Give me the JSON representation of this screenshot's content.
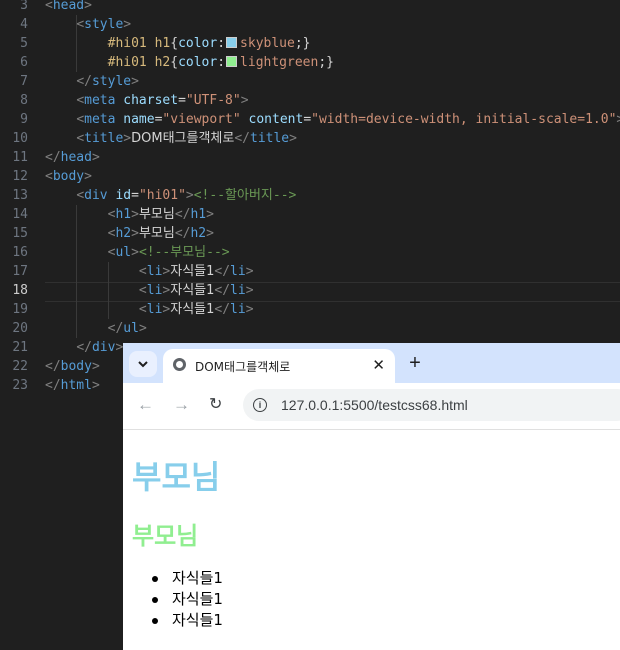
{
  "editor": {
    "line_numbers": [
      "3",
      "4",
      "5",
      "6",
      "7",
      "8",
      "9",
      "10",
      "11",
      "12",
      "13",
      "14",
      "15",
      "16",
      "17",
      "18",
      "19",
      "20",
      "21",
      "22",
      "23"
    ],
    "active_line": "18",
    "lines": {
      "l3": {
        "open": "<",
        "tag": "head",
        "close": ">"
      },
      "l4": {
        "open": "<",
        "tag": "style",
        "close": ">"
      },
      "l5": {
        "sel": "#hi01 h1",
        "brace": "{",
        "prop": "color",
        "colon": ":",
        "swatch": "#87ceeb",
        "val": "skyblue",
        "end": ";}"
      },
      "l6": {
        "sel": "#hi01 h2",
        "brace": "{",
        "prop": "color",
        "colon": ":",
        "swatch": "#90ee90",
        "val": "lightgreen",
        "end": ";}"
      },
      "l7": {
        "open": "</",
        "tag": "style",
        "close": ">"
      },
      "l8": {
        "open": "<",
        "tag": "meta",
        "attr1": "charset",
        "eq": "=",
        "str1": "\"UTF-8\"",
        "close": ">"
      },
      "l9": {
        "open": "<",
        "tag": "meta",
        "attr1": "name",
        "eq": "=",
        "str1": "\"viewport\"",
        "attr2": "content",
        "str2": "\"width=device-width, initial-scale=1.0\"",
        "close": ">"
      },
      "l10": {
        "open": "<",
        "tag": "title",
        "close": ">",
        "text": "DOM태그를객체로",
        "open2": "</",
        "tag2": "title",
        "close2": ">"
      },
      "l11": {
        "open": "</",
        "tag": "head",
        "close": ">"
      },
      "l12": {
        "open": "<",
        "tag": "body",
        "close": ">"
      },
      "l13": {
        "open": "<",
        "tag": "div",
        "attr1": "id",
        "eq": "=",
        "str1": "\"hi01\"",
        "close": ">",
        "comment": "<!--할아버지-->"
      },
      "l14": {
        "open": "<",
        "tag": "h1",
        "close": ">",
        "text": "부모님",
        "open2": "</",
        "tag2": "h1",
        "close2": ">"
      },
      "l15": {
        "open": "<",
        "tag": "h2",
        "close": ">",
        "text": "부모님",
        "open2": "</",
        "tag2": "h2",
        "close2": ">"
      },
      "l16": {
        "open": "<",
        "tag": "ul",
        "close": ">",
        "comment": "<!--부모님-->"
      },
      "l17": {
        "open": "<",
        "tag": "li",
        "close": ">",
        "text": "자식들1",
        "open2": "</",
        "tag2": "li",
        "close2": ">"
      },
      "l18": {
        "open": "<",
        "tag": "li",
        "close": ">",
        "text": "자식들1",
        "open2": "</",
        "tag2": "li",
        "close2": ">"
      },
      "l19": {
        "open": "<",
        "tag": "li",
        "close": ">",
        "text": "자식들1",
        "open2": "</",
        "tag2": "li",
        "close2": ">"
      },
      "l20": {
        "open": "</",
        "tag": "ul",
        "close": ">"
      },
      "l21": {
        "open": "</",
        "tag": "div",
        "close": ">"
      },
      "l22": {
        "open": "</",
        "tag": "body",
        "close": ">"
      },
      "l23": {
        "open": "</",
        "tag": "html",
        "close": ">"
      }
    }
  },
  "browser": {
    "tab_search_icon": "chevron-down-icon",
    "tab": {
      "icon": "globe-icon",
      "title": "DOM태그를객체로",
      "close_glyph": "✕"
    },
    "new_tab_glyph": "+",
    "toolbar": {
      "back_glyph": "←",
      "forward_glyph": "→",
      "reload_glyph": "↻",
      "info_glyph": "i",
      "url": "127.0.0.1:5500/testcss68.html"
    },
    "page": {
      "h1": "부모님",
      "h1_color": "#87ceeb",
      "h2": "부모님",
      "h2_color": "#90ee90",
      "list_items": [
        "자식들1",
        "자식들1",
        "자식들1"
      ]
    }
  }
}
